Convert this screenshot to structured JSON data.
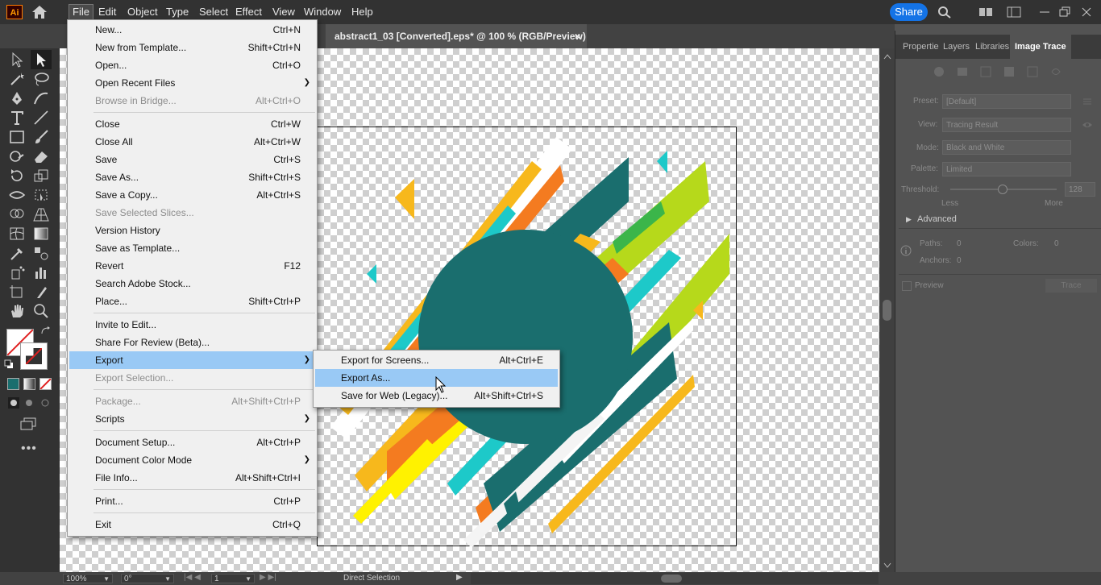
{
  "menubar": {
    "logo": "Ai",
    "items": [
      "File",
      "Edit",
      "Object",
      "Type",
      "Select",
      "Effect",
      "View",
      "Window",
      "Help"
    ],
    "share": "Share"
  },
  "document": {
    "tab_title": "abstract1_03 [Converted].eps* @ 100 % (RGB/Preview)",
    "close": "×"
  },
  "file_menu": {
    "items": [
      {
        "label": "New...",
        "shortcut": "Ctrl+N"
      },
      {
        "label": "New from Template...",
        "shortcut": "Shift+Ctrl+N"
      },
      {
        "label": "Open...",
        "shortcut": "Ctrl+O"
      },
      {
        "label": "Open Recent Files",
        "shortcut": ""
      },
      {
        "label": "Browse in Bridge...",
        "shortcut": "Alt+Ctrl+O"
      },
      {
        "label": "Close",
        "shortcut": "Ctrl+W"
      },
      {
        "label": "Close All",
        "shortcut": "Alt+Ctrl+W"
      },
      {
        "label": "Save",
        "shortcut": "Ctrl+S"
      },
      {
        "label": "Save As...",
        "shortcut": "Shift+Ctrl+S"
      },
      {
        "label": "Save a Copy...",
        "shortcut": "Alt+Ctrl+S"
      },
      {
        "label": "Save Selected Slices...",
        "shortcut": ""
      },
      {
        "label": "Version History",
        "shortcut": ""
      },
      {
        "label": "Save as Template...",
        "shortcut": ""
      },
      {
        "label": "Revert",
        "shortcut": "F12"
      },
      {
        "label": "Search Adobe Stock...",
        "shortcut": ""
      },
      {
        "label": "Place...",
        "shortcut": "Shift+Ctrl+P"
      },
      {
        "label": "Invite to Edit...",
        "shortcut": ""
      },
      {
        "label": "Share For Review (Beta)...",
        "shortcut": ""
      },
      {
        "label": "Export",
        "shortcut": ""
      },
      {
        "label": "Export Selection...",
        "shortcut": ""
      },
      {
        "label": "Package...",
        "shortcut": "Alt+Shift+Ctrl+P"
      },
      {
        "label": "Scripts",
        "shortcut": ""
      },
      {
        "label": "Document Setup...",
        "shortcut": "Alt+Ctrl+P"
      },
      {
        "label": "Document Color Mode",
        "shortcut": ""
      },
      {
        "label": "File Info...",
        "shortcut": "Alt+Shift+Ctrl+I"
      },
      {
        "label": "Print...",
        "shortcut": "Ctrl+P"
      },
      {
        "label": "Exit",
        "shortcut": "Ctrl+Q"
      }
    ]
  },
  "export_submenu": {
    "items": [
      {
        "label": "Export for Screens...",
        "shortcut": "Alt+Ctrl+E"
      },
      {
        "label": "Export As...",
        "shortcut": ""
      },
      {
        "label": "Save for Web (Legacy)...",
        "shortcut": "Alt+Shift+Ctrl+S"
      }
    ]
  },
  "right_panel": {
    "tabs": [
      "Propertie",
      "Layers",
      "Libraries",
      "Image Trace"
    ],
    "preset_label": "Preset:",
    "preset_value": "[Default]",
    "view_label": "View:",
    "view_value": "Tracing Result",
    "mode_label": "Mode:",
    "mode_value": "Black and White",
    "palette_label": "Palette:",
    "palette_value": "Limited",
    "threshold_label": "Threshold:",
    "threshold_value": "128",
    "threshold_level": 0.5,
    "less": "Less",
    "more": "More",
    "advanced": "Advanced",
    "paths_label": "Paths:",
    "paths_value": "0",
    "colors_label": "Colors:",
    "colors_value": "0",
    "anchors_label": "Anchors:",
    "anchors_value": "0",
    "preview": "Preview",
    "trace": "Trace"
  },
  "statusbar": {
    "zoom": "100%",
    "rotation": "0°",
    "artboard": "1",
    "tool": "Direct Selection"
  },
  "colors": {
    "teal": "#1a6e6e",
    "orange": "#f47b20",
    "yellow": "#f7b81c",
    "lime": "#b6d91b",
    "cyan": "#1dc9c9",
    "menu_highlight": "#99c9f5",
    "share_blue": "#1473e6"
  }
}
